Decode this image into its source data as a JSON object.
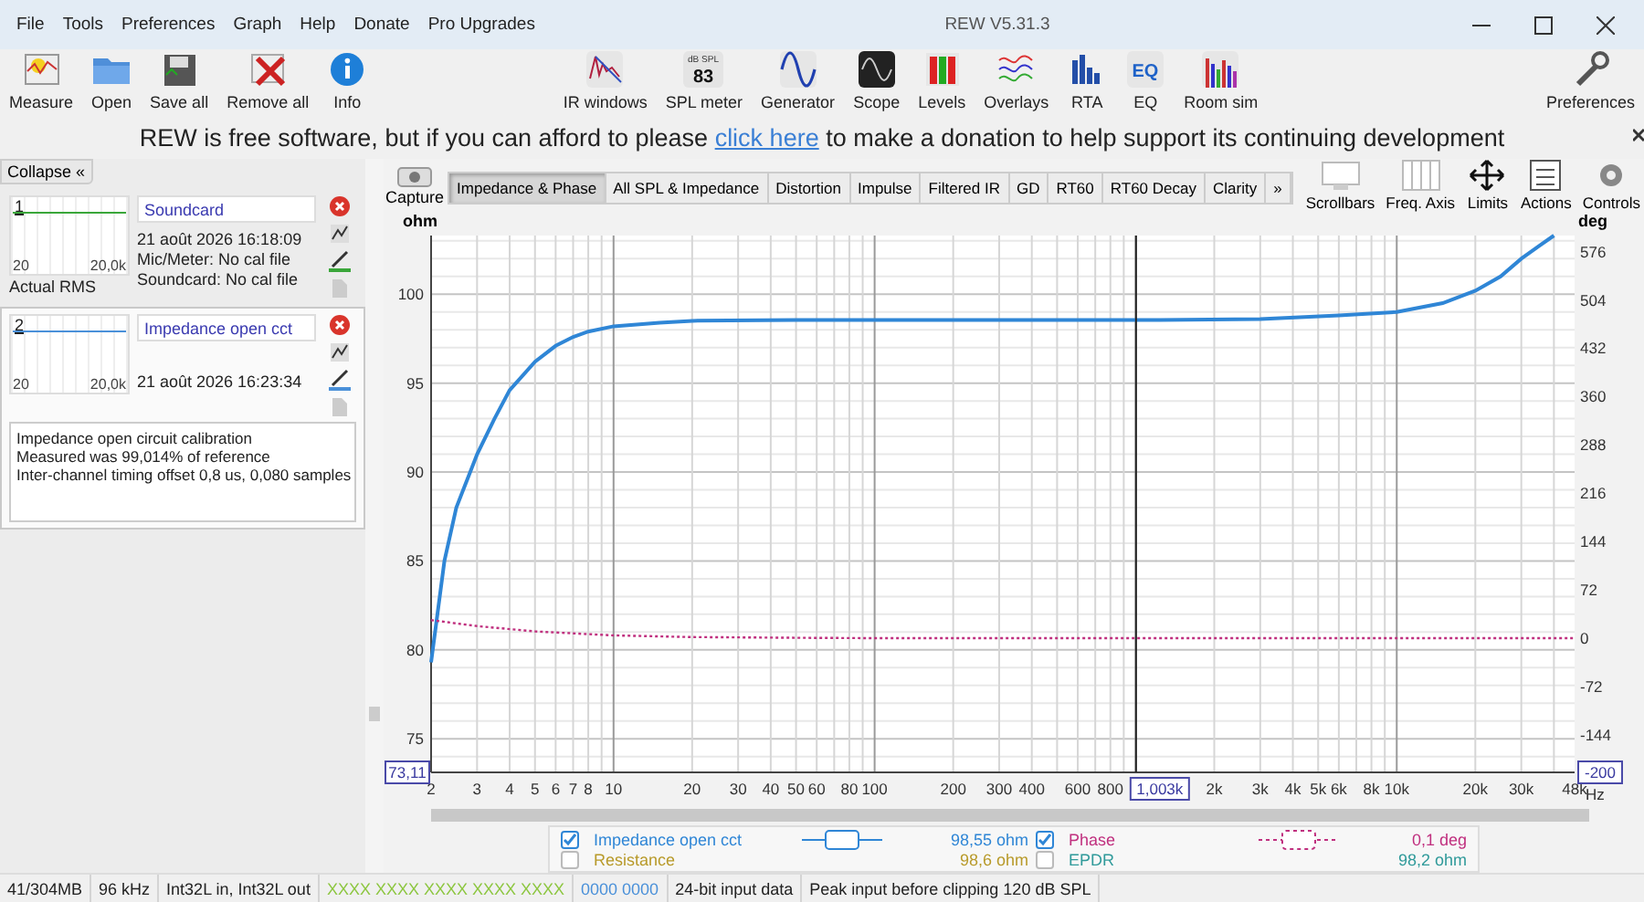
{
  "window": {
    "title": "REW V5.31.3"
  },
  "menu": [
    "File",
    "Tools",
    "Preferences",
    "Graph",
    "Help",
    "Donate",
    "Pro Upgrades"
  ],
  "toolbar": {
    "left": [
      {
        "kind": "measure",
        "label": "Measure"
      },
      {
        "kind": "open",
        "label": "Open"
      },
      {
        "kind": "save",
        "label": "Save all"
      },
      {
        "kind": "remove",
        "label": "Remove all"
      },
      {
        "kind": "info",
        "label": "Info"
      }
    ],
    "center": [
      {
        "kind": "ir",
        "label": "IR windows"
      },
      {
        "kind": "spl",
        "label": "SPL meter",
        "icon_caption": "dB SPL",
        "icon_value": "83"
      },
      {
        "kind": "generator",
        "label": "Generator"
      },
      {
        "kind": "scope",
        "label": "Scope"
      },
      {
        "kind": "levels",
        "label": "Levels"
      },
      {
        "kind": "overlays",
        "label": "Overlays"
      },
      {
        "kind": "rta",
        "label": "RTA"
      },
      {
        "kind": "eq",
        "label": "EQ",
        "icon_text": "EQ"
      },
      {
        "kind": "roomsim",
        "label": "Room sim"
      }
    ],
    "right": [
      {
        "kind": "preferences",
        "label": "Preferences"
      }
    ]
  },
  "banner": {
    "before": "REW is free software, but if you can afford to please ",
    "link": "click here",
    "after": " to make a donation to help support its continuing development"
  },
  "left_panel": {
    "collapse_label": "Collapse",
    "collapse_icon": "«",
    "measurements": [
      {
        "number": "1",
        "name": "Soundcard",
        "selected": false,
        "color": "#3aa63a",
        "date": "21 août 2026 16:18:09",
        "details": [
          "Mic/Meter: No cal file",
          "Soundcard: No cal file"
        ],
        "thumb_labels": [
          "20",
          "20,0k"
        ],
        "caption": "Actual RMS"
      },
      {
        "number": "2",
        "name": "Impedance open cct",
        "selected": true,
        "color": "#4a90d9",
        "date": "21 août 2026 16:23:34",
        "thumb_labels": [
          "20",
          "20,0k"
        ],
        "notes": [
          "Impedance open circuit calibration",
          "Measured was 99,014% of reference",
          "Inter-channel timing offset 0,8 us, 0,080 samples"
        ]
      }
    ]
  },
  "graph": {
    "capture_label": "Capture",
    "tabs": [
      {
        "label": "Impedance & Phase",
        "selected": true
      },
      {
        "label": "All SPL & Impedance",
        "selected": false
      },
      {
        "label": "Distortion",
        "selected": false
      },
      {
        "label": "Impulse",
        "selected": false
      },
      {
        "label": "Filtered IR",
        "selected": false
      },
      {
        "label": "GD",
        "selected": false
      },
      {
        "label": "RT60",
        "selected": false
      },
      {
        "label": "RT60 Decay",
        "selected": false
      },
      {
        "label": "Clarity",
        "selected": false
      }
    ],
    "more_tabs": "»",
    "tools": [
      {
        "kind": "scrollbars",
        "label": "Scrollbars"
      },
      {
        "kind": "freq",
        "label": "Freq. Axis"
      },
      {
        "kind": "limits",
        "label": "Limits"
      },
      {
        "kind": "actions",
        "label": "Actions"
      },
      {
        "kind": "controls",
        "label": "Controls"
      }
    ],
    "cursor": {
      "y_label": "73,11",
      "y2_label": "-200"
    },
    "plot": {
      "y_unit": "ohm",
      "y2_unit": "deg",
      "x_unit": "Hz",
      "x_ticks": [
        "2",
        "3",
        "4",
        "5",
        "6",
        "7",
        "8",
        "10",
        "20",
        "30",
        "40",
        "50",
        "60",
        "80",
        "100",
        "200",
        "300",
        "400",
        "600",
        "800",
        "2k",
        "3k",
        "4k",
        "5k",
        "6k",
        "8k",
        "10k",
        "20k",
        "30k",
        "48k"
      ],
      "y_ticks": [
        "100",
        "95",
        "90",
        "85",
        "80",
        "75"
      ],
      "y2_ticks": [
        "576",
        "504",
        "432",
        "360",
        "288",
        "216",
        "144",
        "72",
        "0",
        "-72",
        "-144"
      ],
      "cursor_x_label": "1,003k",
      "traces": [
        {
          "color": "#2f86d6",
          "kind": "solid"
        },
        {
          "color": "#c0307f",
          "kind": "dotted"
        }
      ]
    }
  },
  "legend": [
    {
      "label": "Impedance open cct",
      "checked": true,
      "color": "#2f86d6",
      "kind": "solid",
      "value": "98,55 ohm"
    },
    {
      "label": "Phase",
      "checked": true,
      "color": "#c0307f",
      "kind": "dotted",
      "value": "0,1 deg"
    },
    {
      "label": "Resistance",
      "checked": false,
      "color": "#b89a2a",
      "kind": "plain",
      "value": "98,6 ohm"
    },
    {
      "label": "EPDR",
      "checked": false,
      "color": "#2f9a9a",
      "kind": "plain",
      "value": "98,2 ohm"
    }
  ],
  "status_bar": [
    {
      "kind": "plain",
      "text": "41/304MB"
    },
    {
      "kind": "plain",
      "text": "96 kHz"
    },
    {
      "kind": "plain",
      "text": "Int32L in, Int32L out"
    },
    {
      "kind": "bits",
      "color": "#8cc63f",
      "text": "XXXX XXXX XXXX XXXX XXXX"
    },
    {
      "kind": "bits",
      "color": "#4a90d9",
      "text": "0000 0000"
    },
    {
      "kind": "plain",
      "text": "24-bit input data"
    },
    {
      "kind": "plain",
      "text": "Peak input before clipping 120 dB SPL"
    }
  ]
}
